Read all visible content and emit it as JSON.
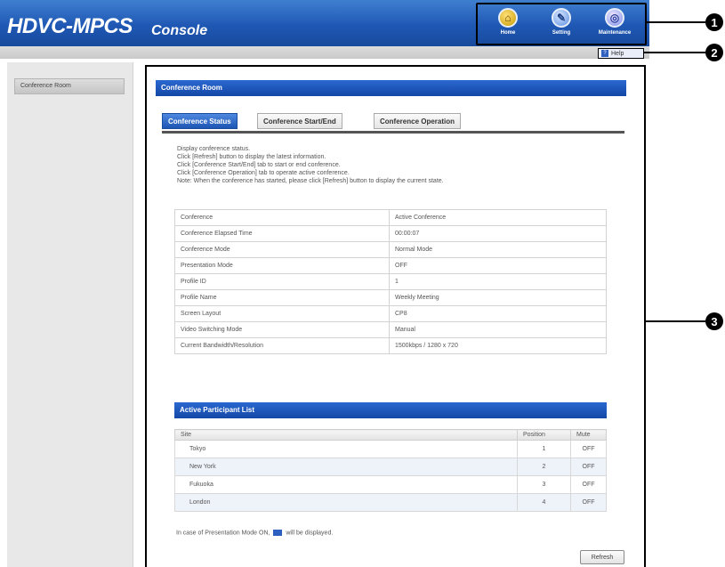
{
  "header": {
    "brand": "HDVC-MPCS",
    "subtitle": "Console",
    "nav": [
      {
        "label": "Home",
        "icon": "home-icon"
      },
      {
        "label": "Setting",
        "icon": "wrench-icon"
      },
      {
        "label": "Maintenance",
        "icon": "maintenance-icon"
      }
    ],
    "help_label": "Help"
  },
  "callouts": [
    "1",
    "2",
    "3"
  ],
  "sidebar": {
    "items": [
      {
        "label": "Conference Room"
      }
    ]
  },
  "main": {
    "title": "Conference Room",
    "tabs": [
      {
        "label": "Conference Status",
        "active": true
      },
      {
        "label": "Conference Start/End",
        "active": false
      },
      {
        "label": "Conference Operation",
        "active": false
      }
    ],
    "description": [
      "Display conference status.",
      "Click [Refresh] button to display the latest information.",
      "Click [Conference Start/End] tab to start or end conference.",
      "Click [Conference Operation] tab to operate active conference.",
      "Note: When the conference has started, please click [Refresh] button to display the current state."
    ],
    "status_rows": [
      [
        "Conference",
        "Active Conference"
      ],
      [
        "Conference Elapsed Time",
        "00:00:07"
      ],
      [
        "Conference Mode",
        "Normal Mode"
      ],
      [
        "Presentation Mode",
        "OFF"
      ],
      [
        "Profile ID",
        "1"
      ],
      [
        "Profile Name",
        "Weekly Meeting"
      ],
      [
        "Screen Layout",
        "CP8"
      ],
      [
        "Video Switching Mode",
        "Manual"
      ],
      [
        "Current Bandwidth/Resolution",
        "1500kbps / 1280 x 720"
      ]
    ],
    "participants": {
      "title": "Active Participant List",
      "columns": [
        "Site",
        "Position",
        "Mute"
      ],
      "rows": [
        [
          "Tokyo",
          "1",
          "OFF"
        ],
        [
          "New York",
          "2",
          "OFF"
        ],
        [
          "Fukuoka",
          "3",
          "OFF"
        ],
        [
          "London",
          "4",
          "OFF"
        ]
      ]
    },
    "note_prefix": "In case of Presentation Mode ON,",
    "note_suffix": "will be displayed.",
    "refresh_label": "Refresh"
  },
  "colors": {
    "header_blue": "#1f58b4",
    "title_blue": "#1447a6"
  }
}
